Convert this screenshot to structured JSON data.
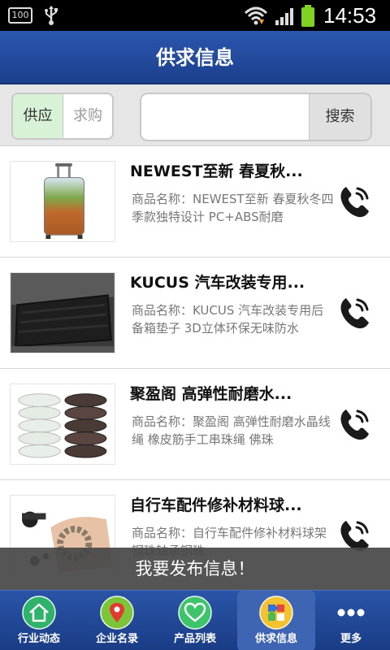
{
  "status_bar": {
    "battery_level_text": "100",
    "time": "14:53",
    "icons": [
      "battery-small-icon",
      "usb-icon",
      "wifi-icon",
      "signal-icon",
      "battery-icon"
    ]
  },
  "header": {
    "title": "供求信息"
  },
  "filter": {
    "supply_label": "供应",
    "demand_label": "求购",
    "selected": "供应",
    "search_value": "",
    "search_button": "搜索"
  },
  "items": [
    {
      "title": "NEWEST至新 春夏秋...",
      "desc": "商品名称：NEWEST至新 春夏秋冬四季款独特设计 PC+ABS耐磨",
      "image": "luggage-image"
    },
    {
      "title": "KUCUS 汽车改装专用...",
      "desc": "商品名称：KUCUS 汽车改装专用后备箱垫子 3D立体环保无味防水",
      "image": "trunk-mat-image"
    },
    {
      "title": "聚盈阁 高弹性耐磨水...",
      "desc": "商品名称：聚盈阁 高弹性耐磨水晶线绳 橡皮筋手工串珠绳 佛珠",
      "image": "cord-spools-image"
    },
    {
      "title": "自行车配件修补材料球...",
      "desc": "商品名称：自行车配件修补材料球架钢珠轴承钢珠",
      "image": "bike-bearing-image"
    }
  ],
  "publish": {
    "label": "我要发布信息！"
  },
  "nav": {
    "items": [
      {
        "label": "行业动态",
        "icon": "home-icon",
        "color": "#2fb36a"
      },
      {
        "label": "企业名录",
        "icon": "map-pin-icon",
        "color": "#7cc43a"
      },
      {
        "label": "产品列表",
        "icon": "heart-icon",
        "color": "#3ec46a"
      },
      {
        "label": "供求信息",
        "icon": "puzzle-icon",
        "color": "#f2c230"
      },
      {
        "label": "更多",
        "icon": "more-icon",
        "color": "#ffffff"
      }
    ],
    "active": "供求信息"
  },
  "colors": {
    "header_blue": "#2b57ae",
    "supply_selected_bg": "#d8f2d8",
    "publish_bar": "#464646"
  }
}
